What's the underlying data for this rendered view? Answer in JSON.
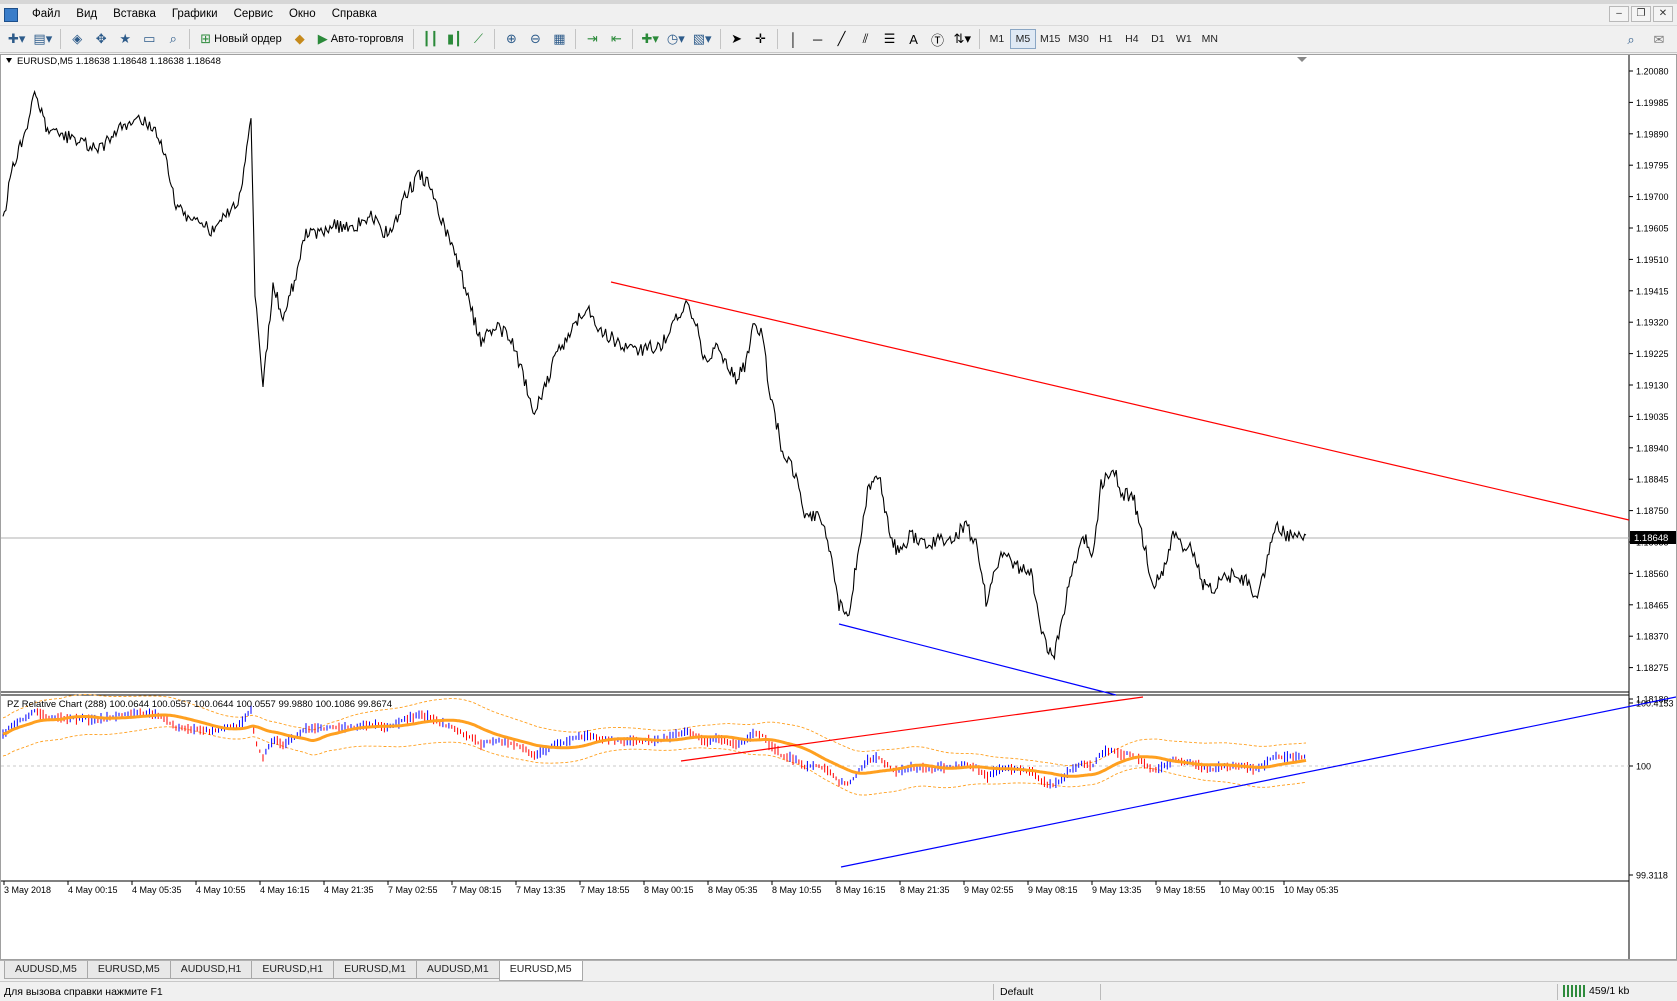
{
  "menu": {
    "items": [
      "Файл",
      "Вид",
      "Вставка",
      "Графики",
      "Сервис",
      "Окно",
      "Справка"
    ]
  },
  "toolbar": {
    "new_order_label": "Новый ордер",
    "autotrading_label": "Авто-торговля",
    "timeframes": [
      "M1",
      "M5",
      "M15",
      "M30",
      "H1",
      "H4",
      "D1",
      "W1",
      "MN"
    ],
    "active_timeframe": "M5"
  },
  "chart": {
    "header": "EURUSD,M5  1.18638 1.18648 1.18638 1.18648",
    "current_price_label": "1.18648",
    "price_ticks": [
      "1.20080",
      "1.19985",
      "1.19890",
      "1.19795",
      "1.19700",
      "1.19605",
      "1.19510",
      "1.19415",
      "1.19320",
      "1.19225",
      "1.19130",
      "1.19035",
      "1.18940",
      "1.18845",
      "1.18750",
      "1.18655",
      "1.18560",
      "1.18465",
      "1.18370",
      "1.18275",
      "1.18180"
    ],
    "indicator_header": "PZ Relative Chart (288) 100.0644 100.0557 100.0644 100.0557 99.9880 100.1086 99.8674",
    "indicator_ticks": [
      "100.4153",
      "100",
      "99.3118"
    ],
    "time_ticks": [
      "3 May 2018",
      "4 May 00:15",
      "4 May 05:35",
      "4 May 10:55",
      "4 May 16:15",
      "4 May 21:35",
      "7 May 02:55",
      "7 May 08:15",
      "7 May 13:35",
      "7 May 18:55",
      "8 May 00:15",
      "8 May 05:35",
      "8 May 10:55",
      "8 May 16:15",
      "8 May 21:35",
      "9 May 02:55",
      "9 May 08:15",
      "9 May 13:35",
      "9 May 18:55",
      "10 May 00:15",
      "10 May 05:35"
    ],
    "colors": {
      "price_line": "#000000",
      "resistance_line": "#ff0000",
      "support_line": "#0000ff",
      "ma_line": "#ffa020",
      "band_line": "#ffa020",
      "bar_up": "#0000ff",
      "bar_down": "#ff0000"
    }
  },
  "tabs": [
    "AUDUSD,M5",
    "EURUSD,M5",
    "AUDUSD,H1",
    "EURUSD,H1",
    "EURUSD,M1",
    "AUDUSD,M1",
    "EURUSD,M5"
  ],
  "active_tab_index": 6,
  "status": {
    "help": "Для вызова справки нажмите F1",
    "profile": "Default",
    "traffic": "459/1 kb"
  }
}
